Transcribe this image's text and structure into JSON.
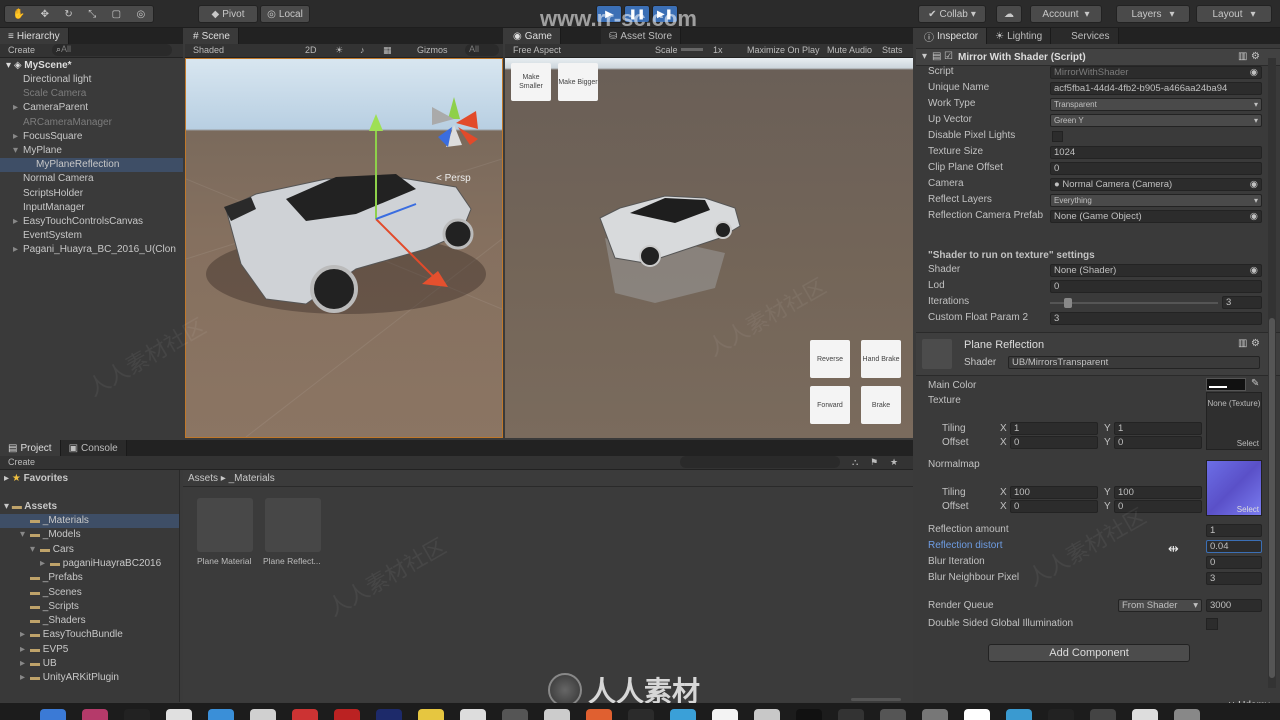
{
  "toolbar": {
    "pivot": "Pivot",
    "local": "Local",
    "collab": "Collab",
    "account": "Account",
    "layers": "Layers",
    "layout": "Layout",
    "watermark_url": "www.rr-sc.com"
  },
  "hierarchy": {
    "tab": "Hierarchy",
    "create": "Create",
    "search_placeholder": "All",
    "scene": "MyScene*",
    "items": [
      {
        "label": "Directional light",
        "indent": 1
      },
      {
        "label": "Scale Camera",
        "indent": 1
      },
      {
        "label": "CameraParent",
        "indent": 1
      },
      {
        "label": "ARCameraManager",
        "indent": 1
      },
      {
        "label": "FocusSquare",
        "indent": 1
      },
      {
        "label": "MyPlane",
        "indent": 1
      },
      {
        "label": "MyPlaneReflection",
        "indent": 2
      },
      {
        "label": "Normal Camera",
        "indent": 1
      },
      {
        "label": "ScriptsHolder",
        "indent": 1
      },
      {
        "label": "InputManager",
        "indent": 1
      },
      {
        "label": "EasyTouchControlsCanvas",
        "indent": 1
      },
      {
        "label": "EventSystem",
        "indent": 1
      },
      {
        "label": "Pagani_Huayra_BC_2016_U(Clon",
        "indent": 1
      }
    ]
  },
  "scene": {
    "tab": "Scene",
    "shaded": "Shaded",
    "mode2d": "2D",
    "gizmos": "Gizmos",
    "search_placeholder": "All",
    "persp": "Persp"
  },
  "game": {
    "tab": "Game",
    "asset_store_tab": "Asset Store",
    "aspect": "Free Aspect",
    "scale_label": "Scale",
    "scale_value": "1x",
    "maximize": "Maximize On Play",
    "mute": "Mute Audio",
    "stats": "Stats",
    "buttons": {
      "make_smaller": "Make Smaller",
      "make_bigger": "Make Bigger",
      "reverse": "Reverse",
      "hand_brake": "Hand Brake",
      "forward": "Forward",
      "brake": "Brake"
    }
  },
  "project": {
    "tab": "Project",
    "console_tab": "Console",
    "create": "Create",
    "favorites": "Favorites",
    "assets": "Assets",
    "tree": [
      {
        "label": "_Materials",
        "indent": 2
      },
      {
        "label": "_Models",
        "indent": 2
      },
      {
        "label": "Cars",
        "indent": 3
      },
      {
        "label": "paganiHuayraBC2016",
        "indent": 4
      },
      {
        "label": "_Prefabs",
        "indent": 2
      },
      {
        "label": "_Scenes",
        "indent": 2
      },
      {
        "label": "_Scripts",
        "indent": 2
      },
      {
        "label": "_Shaders",
        "indent": 2
      },
      {
        "label": "EasyTouchBundle",
        "indent": 2
      },
      {
        "label": "EVP5",
        "indent": 2
      },
      {
        "label": "UB",
        "indent": 2
      },
      {
        "label": "UnityARKitPlugin",
        "indent": 2
      }
    ],
    "breadcrumb_root": "Assets",
    "breadcrumb_folder": "_Materials",
    "files": [
      {
        "label": "Plane Material"
      },
      {
        "label": "Plane Reflect..."
      }
    ]
  },
  "inspector": {
    "tab": "Inspector",
    "lighting_tab": "Lighting",
    "services_tab": "Services",
    "component_title": "Mirror With Shader (Script)",
    "fields": [
      {
        "label": "Script",
        "value": "MirrorWithShader"
      },
      {
        "label": "Unique Name",
        "value": "acf5fba1-44d4-4fb2-b905-a466aa24ba94"
      },
      {
        "label": "Work Type",
        "value": "Transparent"
      },
      {
        "label": "Up Vector",
        "value": "Green Y"
      },
      {
        "label": "Disable Pixel Lights",
        "value": ""
      },
      {
        "label": "Texture Size",
        "value": "1024"
      },
      {
        "label": "Clip Plane Offset",
        "value": "0"
      },
      {
        "label": "Camera",
        "value": "Normal Camera (Camera)"
      },
      {
        "label": "Reflect Layers",
        "value": "Everything"
      },
      {
        "label": "Reflection Camera Prefab",
        "value": "None (Game Object)"
      }
    ],
    "shader_settings_title": "\"Shader to run on texture\" settings",
    "shader_fields": [
      {
        "label": "Shader",
        "value": "None (Shader)"
      },
      {
        "label": "Lod",
        "value": "0"
      },
      {
        "label": "Iterations",
        "value": "3"
      },
      {
        "label": "Custom Float Param 2",
        "value": "3"
      }
    ],
    "material_title": "Plane Reflection",
    "material_shader_label": "Shader",
    "material_shader_value": "UB/MirrorsTransparent",
    "main_color": "Main Color",
    "texture": "Texture",
    "none_texture": "None (Texture)",
    "select": "Select",
    "tiling": "Tiling",
    "offset": "Offset",
    "x": "X",
    "y": "Y",
    "tex_tiling_x": "1",
    "tex_tiling_y": "1",
    "tex_offset_x": "0",
    "tex_offset_y": "0",
    "normalmap": "Normalmap",
    "nm_tiling_x": "100",
    "nm_tiling_y": "100",
    "nm_offset_x": "0",
    "nm_offset_y": "0",
    "props": [
      {
        "label": "Reflection amount",
        "value": "1"
      },
      {
        "label": "Reflection distort",
        "value": "0.04"
      },
      {
        "label": "Blur Iteration",
        "value": "0"
      },
      {
        "label": "Blur Neighbour Pixel",
        "value": "3"
      }
    ],
    "render_queue": "Render Queue",
    "render_queue_mode": "From Shader",
    "render_queue_value": "3000",
    "double_sided": "Double Sided Global Illumination",
    "add_component": "Add Component"
  },
  "watermark": {
    "brand": "人人素材",
    "udemy": "Udemy"
  },
  "colors": {
    "accent": "#3b6fb5",
    "selection": "#3e4e66",
    "highlight_text": "#6e9de4"
  }
}
